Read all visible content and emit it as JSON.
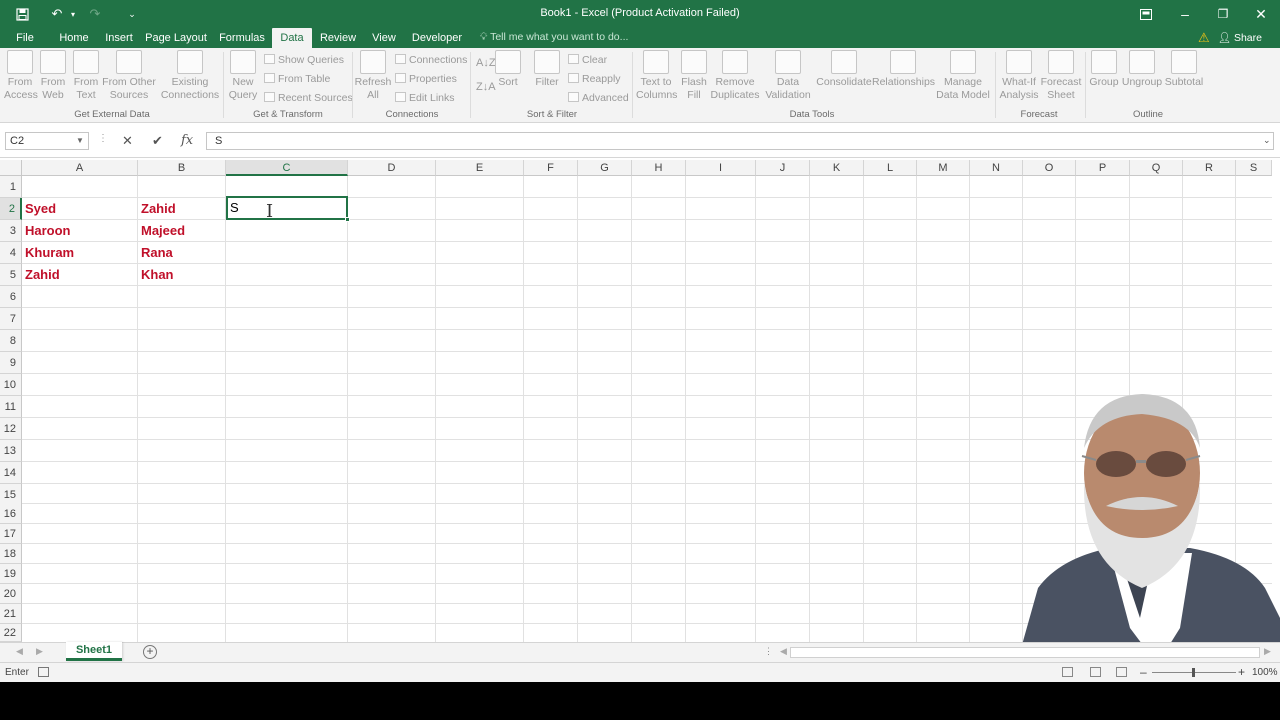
{
  "titlebar": {
    "title": "Book1 - Excel (Product Activation Failed)",
    "colors": {
      "bg": "#217346"
    }
  },
  "tabs": [
    "File",
    "Home",
    "Insert",
    "Page Layout",
    "Formulas",
    "Data",
    "Review",
    "View",
    "Developer"
  ],
  "active_tab": "Data",
  "tell_me": "Tell me what you want to do...",
  "share_label": "Share",
  "ribbon": {
    "get_external_data": {
      "label": "Get External Data",
      "from_access": [
        "From",
        "Access"
      ],
      "from_web": [
        "From",
        "Web"
      ],
      "from_text": [
        "From",
        "Text"
      ],
      "from_other": [
        "From Other",
        "Sources"
      ],
      "existing": [
        "Existing",
        "Connections"
      ]
    },
    "get_transform": {
      "label": "Get & Transform",
      "new_query": [
        "New",
        "Query"
      ],
      "show_queries": "Show Queries",
      "from_table": "From Table",
      "recent_sources": "Recent Sources"
    },
    "connections": {
      "label": "Connections",
      "refresh": [
        "Refresh",
        "All"
      ],
      "connections": "Connections",
      "properties": "Properties",
      "edit_links": "Edit Links"
    },
    "sort_filter": {
      "label": "Sort & Filter",
      "sort": "Sort",
      "filter": "Filter",
      "clear": "Clear",
      "reapply": "Reapply",
      "advanced": "Advanced"
    },
    "data_tools": {
      "label": "Data Tools",
      "text_to_columns": [
        "Text to",
        "Columns"
      ],
      "flash_fill": [
        "Flash",
        "Fill"
      ],
      "remove_duplicates": [
        "Remove",
        "Duplicates"
      ],
      "data_validation": [
        "Data",
        "Validation"
      ],
      "consolidate": "Consolidate",
      "relationships": "Relationships",
      "manage_model": [
        "Manage",
        "Data Model"
      ]
    },
    "forecast": {
      "label": "Forecast",
      "what_if": [
        "What-If",
        "Analysis"
      ],
      "forecast_sheet": [
        "Forecast",
        "Sheet"
      ]
    },
    "outline": {
      "label": "Outline",
      "group": "Group",
      "ungroup": "Ungroup",
      "subtotal": "Subtotal"
    }
  },
  "formula_bar": {
    "name_box": "C2",
    "content": "S"
  },
  "columns": [
    "A",
    "B",
    "C",
    "D",
    "E",
    "F",
    "G",
    "H",
    "I",
    "J",
    "K",
    "L",
    "M",
    "N",
    "O",
    "P",
    "Q",
    "R",
    "S"
  ],
  "rows": [
    "1",
    "2",
    "3",
    "4",
    "5",
    "6",
    "7",
    "8",
    "9",
    "10",
    "11",
    "12",
    "13",
    "14",
    "15",
    "16",
    "17",
    "18",
    "19",
    "20",
    "21",
    "22"
  ],
  "cells": {
    "A2": "Syed",
    "B2": "Zahid",
    "A3": "Haroon",
    "B3": "Majeed",
    "A4": "Khuram",
    "B4": "Rana",
    "A5": "Zahid",
    "B5": "Khan",
    "C2": "S"
  },
  "cell_text_color": "#c0102a",
  "sheet_tab": "Sheet1",
  "status": {
    "mode": "Enter",
    "zoom": "100%"
  }
}
